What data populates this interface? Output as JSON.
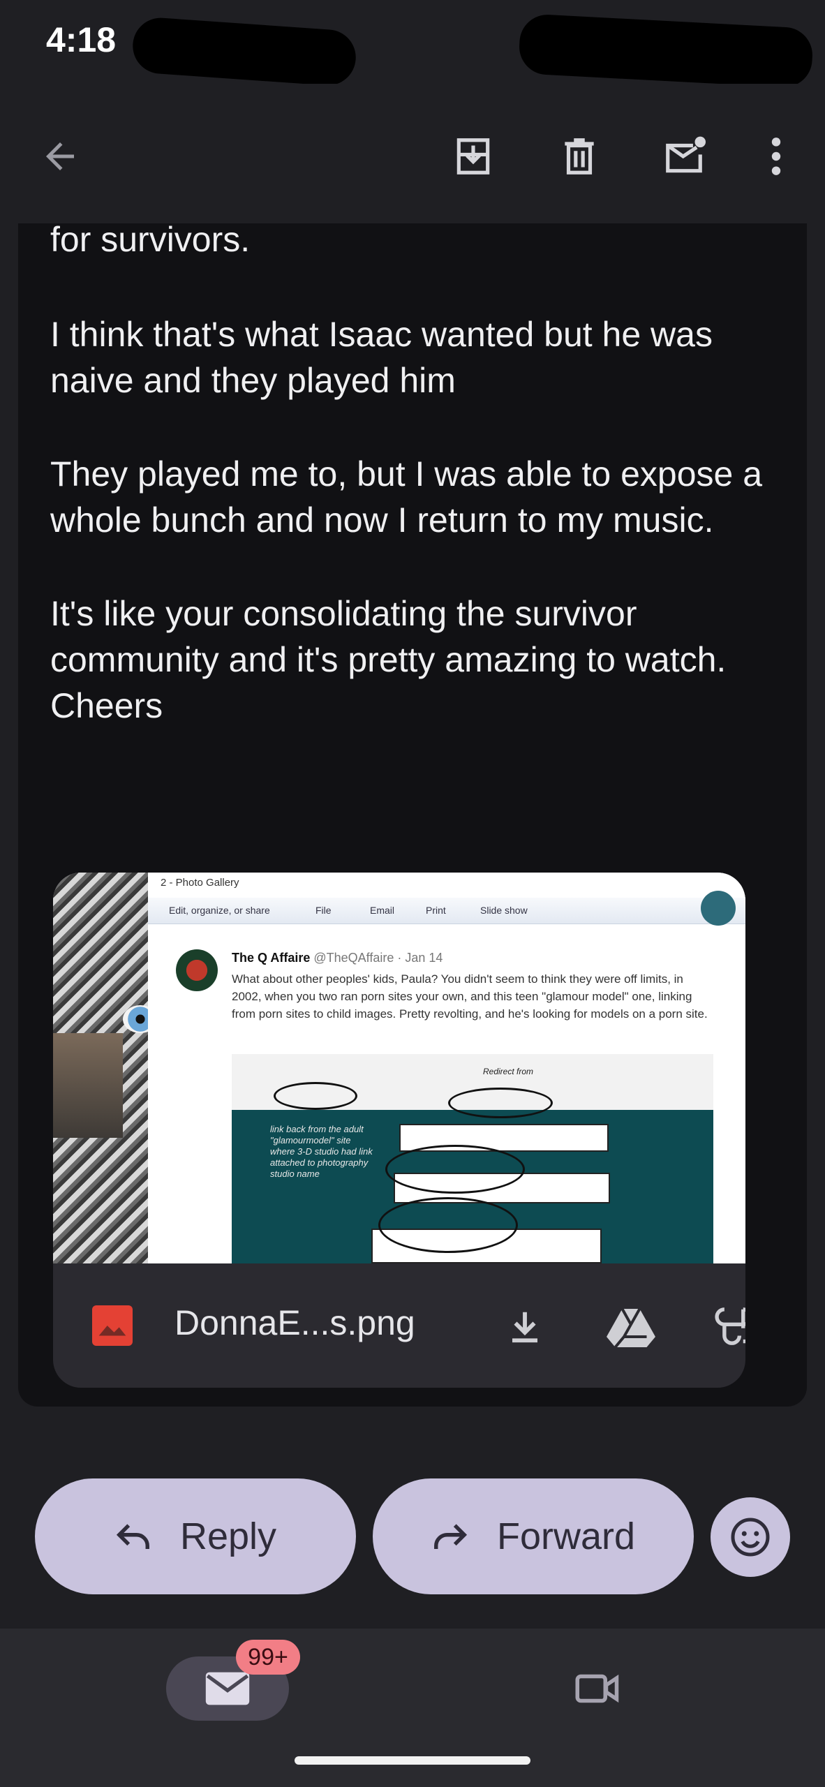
{
  "status": {
    "time": "4:18"
  },
  "toolbar": {
    "back_icon": "arrow-back-icon",
    "archive_icon": "archive-icon",
    "delete_icon": "trash-icon",
    "mark_unread_icon": "mark-unread-icon",
    "more_icon": "more-vert-icon"
  },
  "message": {
    "paragraphs": [
      "for survivors.",
      "I think that's what Isaac wanted but he was naive and they played him",
      "They played me to, but I was able to expose a whole bunch and now I return to my music.",
      "It's like your consolidating the survivor community and it's pretty amazing to watch. Cheers"
    ]
  },
  "attachment": {
    "file_name": "DonnaE...s.png",
    "preview": {
      "window_title": "2 - Photo Gallery",
      "menu": [
        "Edit, organize, or share",
        "File",
        "Email",
        "Print",
        "Slide show"
      ],
      "tweet_author": "The Q Affaire",
      "tweet_handle": "@TheQAffaire · Jan 14",
      "tweet_text": "What about other peoples' kids, Paula? You didn't seem to think they were off limits, in 2002, when you two ran porn sites your own, and this teen \"glamour model\" one, linking from porn sites to child images. Pretty revolting, and he's looking for models on a porn site.",
      "annotation": "link back from the adult \"glamourmodel\" site where 3-D studio had link attached to photography studio name",
      "redirect_label": "Redirect from"
    }
  },
  "actions": {
    "reply_label": "Reply",
    "forward_label": "Forward"
  },
  "nav": {
    "mail_badge": "99+"
  },
  "colors": {
    "background": "#1f1f23",
    "card": "#111114",
    "pill": "#c9c3de",
    "badge": "#f27e86",
    "image_icon": "#e44134"
  }
}
